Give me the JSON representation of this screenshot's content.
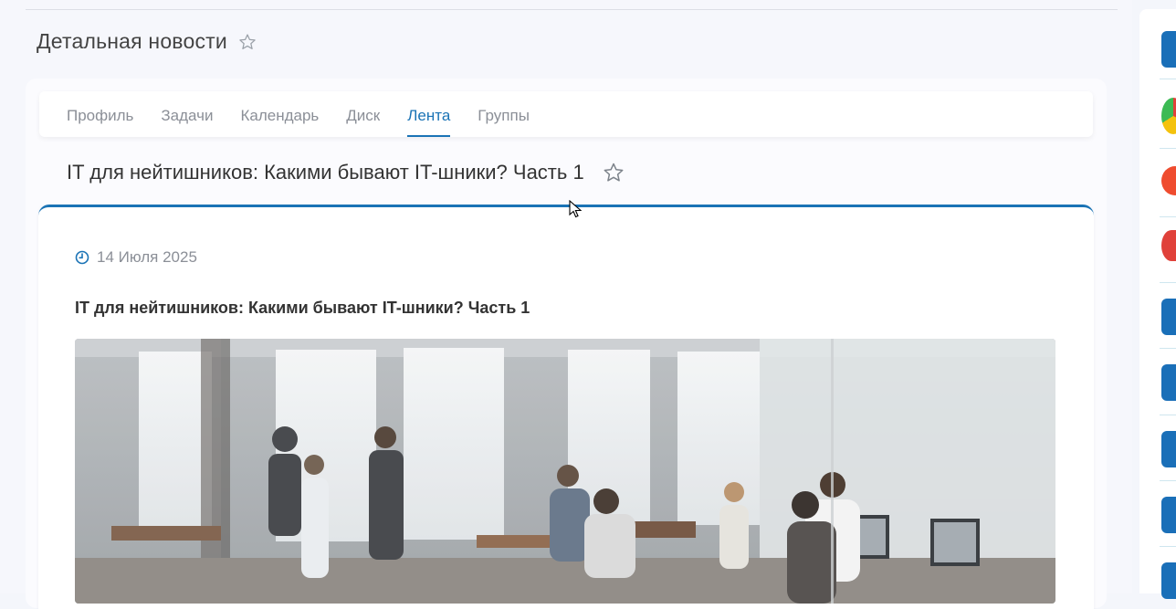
{
  "page": {
    "title": "Детальная новости"
  },
  "tabs": [
    {
      "label": "Профиль",
      "active": false
    },
    {
      "label": "Задачи",
      "active": false
    },
    {
      "label": "Календарь",
      "active": false
    },
    {
      "label": "Диск",
      "active": false
    },
    {
      "label": "Лента",
      "active": true
    },
    {
      "label": "Группы",
      "active": false
    }
  ],
  "news": {
    "heading": "IT для нейтишников: Какими бывают IT-шники? Часть 1",
    "date": "14 Июля 2025",
    "article_title": "IT для нейтишников: Какими бывают IT-шники? Часть 1"
  },
  "colors": {
    "accent": "#1a73b5",
    "muted": "#8b8f97"
  },
  "right_rail": {
    "items": [
      {
        "icon": "app-tile-icon",
        "color": "#1a6fb8"
      },
      {
        "icon": "chrome-icon",
        "color": "#e0413a"
      },
      {
        "icon": "user-badge-icon",
        "color": "#ef4c2f"
      },
      {
        "icon": "heart-icon",
        "color": "#e0413a"
      },
      {
        "icon": "app-tile-icon",
        "color": "#1a6fb8"
      },
      {
        "icon": "app-tile-icon",
        "color": "#1a6fb8"
      },
      {
        "icon": "app-tile-icon",
        "color": "#1a6fb8"
      },
      {
        "icon": "app-tile-icon",
        "color": "#1a6fb8"
      },
      {
        "icon": "app-tile-icon",
        "color": "#1a6fb8"
      }
    ]
  }
}
